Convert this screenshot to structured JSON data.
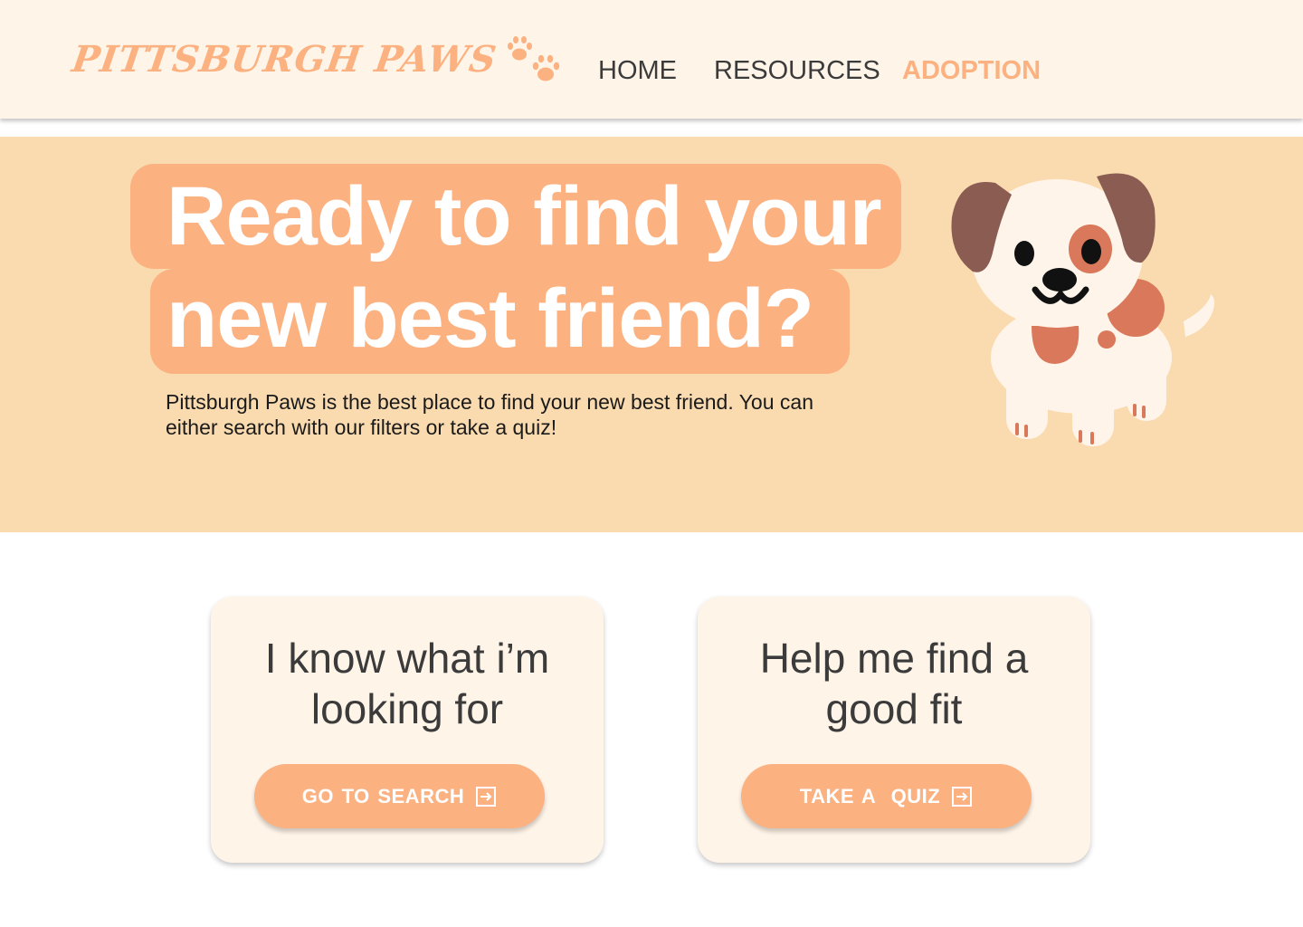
{
  "header": {
    "logo_text": "PITTSBURGH PAWS",
    "logo_icon": "paw-prints-icon",
    "nav": {
      "home": "HOME",
      "resources": "RESOURCES",
      "adoption": "ADOPTION"
    },
    "active_nav": "adoption"
  },
  "hero": {
    "headline_line1": "Ready to find your",
    "headline_line2": "new best friend?",
    "description": "Pittsburgh Paws is the best place to find your new best friend. You can either search with our filters or take a quiz!",
    "illustration": "puppy-illustration"
  },
  "cards": {
    "search": {
      "title": "I know what i’m looking for",
      "button_label": "GO TO SEARCH",
      "button_icon": "arrow-right-box-icon"
    },
    "quiz": {
      "title": "Help me find a good fit",
      "button_label": "TAKE A  QUIZ",
      "button_icon": "arrow-right-box-icon"
    }
  },
  "colors": {
    "accent": "#fbb180",
    "header_bg": "#fff4e8",
    "hero_bg": "#fadbb0",
    "card_bg": "#fff4e8",
    "text_dark": "#3b3b3b"
  }
}
